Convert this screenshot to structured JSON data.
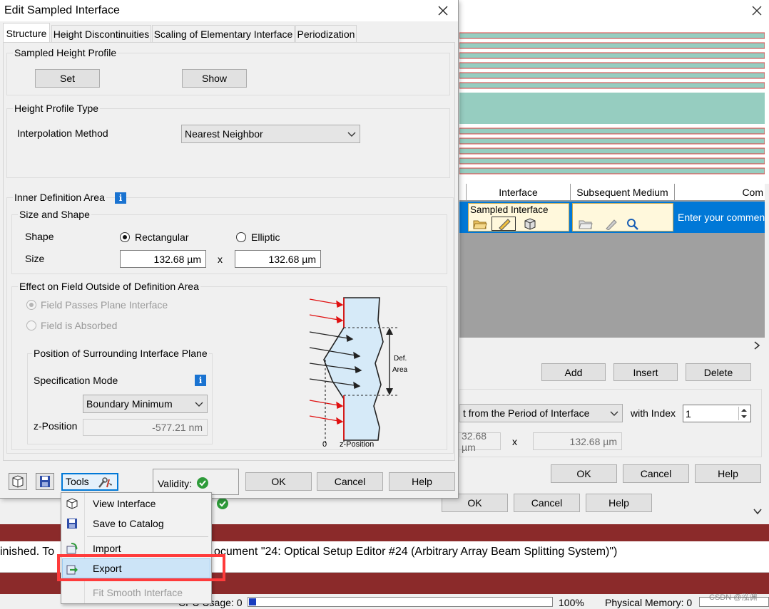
{
  "dialog": {
    "title": "Edit Sampled Interface",
    "tabs": [
      "Structure",
      "Height Discontinuities",
      "Scaling of Elementary Interface",
      "Periodization"
    ],
    "sampled_height_profile": {
      "group_label": "Sampled Height Profile",
      "set_label": "Set",
      "show_label": "Show"
    },
    "height_profile_type": {
      "group_label": "Height Profile Type",
      "interpolation_label": "Interpolation Method",
      "interpolation_value": "Nearest Neighbor"
    },
    "inner_definition": {
      "group_label": "Inner Definition Area",
      "size_shape_label": "Size and Shape",
      "shape_label": "Shape",
      "rectangular_label": "Rectangular",
      "elliptic_label": "Elliptic",
      "size_label": "Size",
      "size_x": "132.68 µm",
      "times": "x",
      "size_y": "132.68 µm"
    },
    "effect_outside": {
      "group_label": "Effect on Field Outside of Definition Area",
      "passes_label": "Field Passes Plane Interface",
      "absorbed_label": "Field is Absorbed",
      "position_group_label": "Position of Surrounding Interface Plane",
      "spec_mode_label": "Specification Mode",
      "spec_mode_value": "Boundary Minimum",
      "zpos_label": "z-Position",
      "zpos_value": "-577.21 nm",
      "diagram": {
        "def_area_label": "Def.",
        "def_area_label2": "Area",
        "zero_label": "0",
        "zpos_label": "z-Position"
      }
    },
    "bottom": {
      "tools_label": "Tools",
      "validity_label": "Validity:",
      "ok_label": "OK",
      "cancel_label": "Cancel",
      "help_label": "Help"
    }
  },
  "tools_menu": {
    "items": [
      {
        "label": "View Interface",
        "icon": "3d-view-icon",
        "enabled": true
      },
      {
        "label": "Save to Catalog",
        "icon": "save-disk-icon",
        "enabled": true
      },
      {
        "label": "Import",
        "icon": "import-icon",
        "enabled": true
      },
      {
        "label": "Export",
        "icon": "export-icon",
        "enabled": true,
        "highlighted": true
      },
      {
        "label": "Fit Smooth Interface",
        "icon": "",
        "enabled": false
      }
    ]
  },
  "background_window": {
    "table_headers": [
      "Interface",
      "Subsequent Medium",
      "Com"
    ],
    "row_interface": "Sampled Interface",
    "comment_placeholder": "Enter your comment",
    "add_label": "Add",
    "insert_label": "Insert",
    "delete_label": "Delete",
    "period_value": "t from the Period of Interface",
    "with_index_label": "with Index",
    "index_value": "1",
    "size_x_partial": "32.68 µm",
    "times": "x",
    "size_y": "132.68 µm",
    "ok_label": "OK",
    "cancel_label": "Cancel",
    "help_label": "Help"
  },
  "third_window": {
    "ok_label": "OK",
    "cancel_label": "Cancel",
    "help_label": "Help"
  },
  "status": {
    "message": "inished. To",
    "message2": "ocument \"24: Optical Setup Editor #24 (Arbitrary Array Beam Splitting System)\")",
    "cpu_label": "CPU Usage: 0",
    "cpu_percent": "100%",
    "memory_label": "Physical Memory: 0",
    "watermark": "CSDN @泓渊"
  },
  "colors": {
    "accent_blue": "#0078d7",
    "highlight_red": "#ff3b3b",
    "teal": "#96cdc0",
    "status_dark_red": "#8b2a2a"
  }
}
